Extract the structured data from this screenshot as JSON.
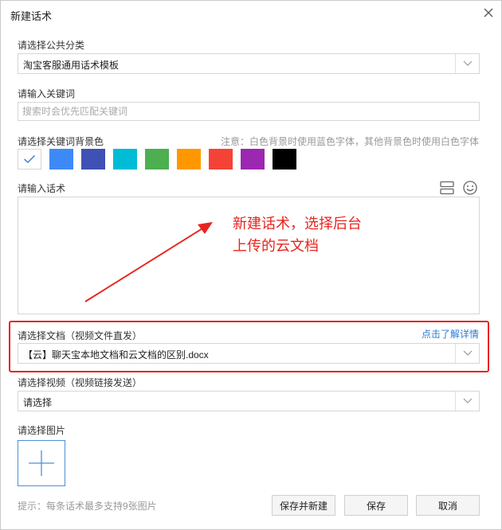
{
  "window": {
    "title": "新建话术"
  },
  "category": {
    "label": "请选择公共分类",
    "value": "淘宝客服通用话术模板"
  },
  "keyword": {
    "label": "请输入关键词",
    "placeholder": "搜索时会优先匹配关键词",
    "value": ""
  },
  "bg_color": {
    "label": "请选择关键词背景色",
    "note": "注意：白色背景时使用蓝色字体，其他背景色时使用白色字体",
    "swatches": [
      "#ffffff",
      "#3d8af7",
      "#3f51b5",
      "#00bcd4",
      "#4caf50",
      "#ff9800",
      "#f44336",
      "#9c27b0",
      "#000000"
    ],
    "selected": "#ffffff"
  },
  "script_text": {
    "label": "请输入话术",
    "value": ""
  },
  "annotation": {
    "line1": "新建话术，选择后台",
    "line2": "上传的云文档"
  },
  "document": {
    "label": "请选择文档（视频文件直发）",
    "link": "点击了解详情",
    "value": "【云】聊天宝本地文档和云文档的区别.docx"
  },
  "video": {
    "label": "请选择视频（视频链接发送）",
    "value": "请选择"
  },
  "image": {
    "label": "请选择图片",
    "hint": "提示：每条话术最多支持9张图片"
  },
  "buttons": {
    "save_new": "保存并新建",
    "save": "保存",
    "cancel": "取消"
  }
}
